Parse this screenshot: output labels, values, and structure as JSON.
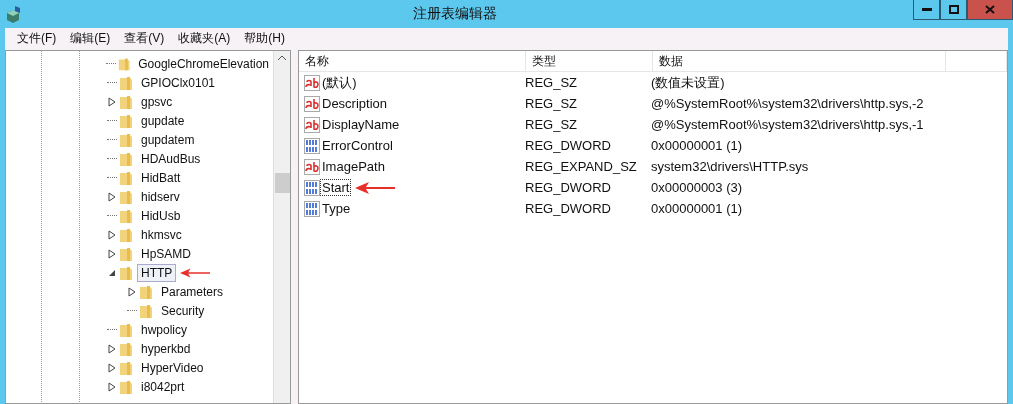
{
  "window": {
    "title": "注册表编辑器"
  },
  "menu": [
    "文件(F)",
    "编辑(E)",
    "查看(V)",
    "收藏夹(A)",
    "帮助(H)"
  ],
  "tree": [
    {
      "label": "GoogleChromeElevation",
      "expandable": false,
      "selected": false,
      "marked": false
    },
    {
      "label": "GPIOClx0101",
      "expandable": false,
      "selected": false,
      "marked": false
    },
    {
      "label": "gpsvc",
      "expandable": true,
      "selected": false,
      "marked": false
    },
    {
      "label": "gupdate",
      "expandable": false,
      "selected": false,
      "marked": false
    },
    {
      "label": "gupdatem",
      "expandable": false,
      "selected": false,
      "marked": false
    },
    {
      "label": "HDAudBus",
      "expandable": false,
      "selected": false,
      "marked": false
    },
    {
      "label": "HidBatt",
      "expandable": false,
      "selected": false,
      "marked": false
    },
    {
      "label": "hidserv",
      "expandable": true,
      "selected": false,
      "marked": false
    },
    {
      "label": "HidUsb",
      "expandable": false,
      "selected": false,
      "marked": false
    },
    {
      "label": "hkmsvc",
      "expandable": true,
      "selected": false,
      "marked": false
    },
    {
      "label": "HpSAMD",
      "expandable": true,
      "selected": false,
      "marked": false
    },
    {
      "label": "HTTP",
      "expandable": true,
      "expanded": true,
      "selected": true,
      "marked": true,
      "children": [
        {
          "label": "Parameters",
          "expandable": true,
          "selected": false,
          "marked": false
        },
        {
          "label": "Security",
          "expandable": false,
          "selected": false,
          "marked": false
        }
      ]
    },
    {
      "label": "hwpolicy",
      "expandable": false,
      "selected": false,
      "marked": false
    },
    {
      "label": "hyperkbd",
      "expandable": true,
      "selected": false,
      "marked": false
    },
    {
      "label": "HyperVideo",
      "expandable": true,
      "selected": false,
      "marked": false
    },
    {
      "label": "i8042prt",
      "expandable": true,
      "selected": false,
      "marked": false
    }
  ],
  "table": {
    "columns": [
      "名称",
      "类型",
      "数据"
    ],
    "rows": [
      {
        "kind": "string",
        "name": "(默认)",
        "type": "REG_SZ",
        "data": "(数值未设置)",
        "focused": false,
        "marked": false
      },
      {
        "kind": "string",
        "name": "Description",
        "type": "REG_SZ",
        "data": "@%SystemRoot%\\system32\\drivers\\http.sys,-2",
        "focused": false,
        "marked": false
      },
      {
        "kind": "string",
        "name": "DisplayName",
        "type": "REG_SZ",
        "data": "@%SystemRoot%\\system32\\drivers\\http.sys,-1",
        "focused": false,
        "marked": false
      },
      {
        "kind": "binary",
        "name": "ErrorControl",
        "type": "REG_DWORD",
        "data": "0x00000001 (1)",
        "focused": false,
        "marked": false
      },
      {
        "kind": "string",
        "name": "ImagePath",
        "type": "REG_EXPAND_SZ",
        "data": "system32\\drivers\\HTTP.sys",
        "focused": false,
        "marked": false
      },
      {
        "kind": "binary",
        "name": "Start",
        "type": "REG_DWORD",
        "data": "0x00000003 (3)",
        "focused": true,
        "marked": true
      },
      {
        "kind": "binary",
        "name": "Type",
        "type": "REG_DWORD",
        "data": "0x00000001 (1)",
        "focused": false,
        "marked": false
      }
    ]
  }
}
